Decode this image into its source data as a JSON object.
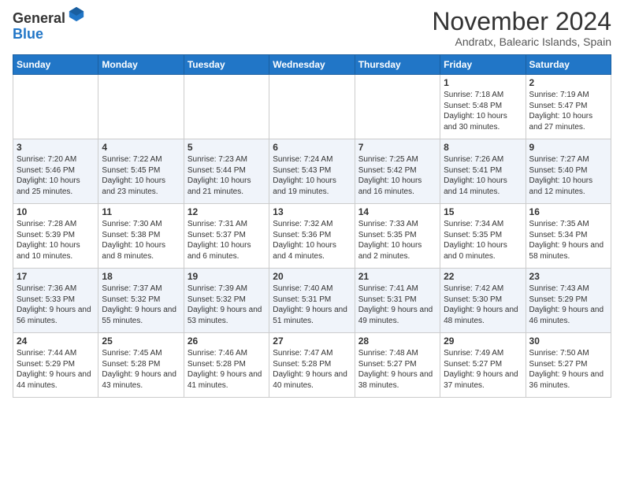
{
  "header": {
    "logo_line1": "General",
    "logo_line2": "Blue",
    "month_title": "November 2024",
    "location": "Andratx, Balearic Islands, Spain"
  },
  "days_of_week": [
    "Sunday",
    "Monday",
    "Tuesday",
    "Wednesday",
    "Thursday",
    "Friday",
    "Saturday"
  ],
  "weeks": [
    [
      {
        "day": "",
        "info": ""
      },
      {
        "day": "",
        "info": ""
      },
      {
        "day": "",
        "info": ""
      },
      {
        "day": "",
        "info": ""
      },
      {
        "day": "",
        "info": ""
      },
      {
        "day": "1",
        "info": "Sunrise: 7:18 AM\nSunset: 5:48 PM\nDaylight: 10 hours and 30 minutes."
      },
      {
        "day": "2",
        "info": "Sunrise: 7:19 AM\nSunset: 5:47 PM\nDaylight: 10 hours and 27 minutes."
      }
    ],
    [
      {
        "day": "3",
        "info": "Sunrise: 7:20 AM\nSunset: 5:46 PM\nDaylight: 10 hours and 25 minutes."
      },
      {
        "day": "4",
        "info": "Sunrise: 7:22 AM\nSunset: 5:45 PM\nDaylight: 10 hours and 23 minutes."
      },
      {
        "day": "5",
        "info": "Sunrise: 7:23 AM\nSunset: 5:44 PM\nDaylight: 10 hours and 21 minutes."
      },
      {
        "day": "6",
        "info": "Sunrise: 7:24 AM\nSunset: 5:43 PM\nDaylight: 10 hours and 19 minutes."
      },
      {
        "day": "7",
        "info": "Sunrise: 7:25 AM\nSunset: 5:42 PM\nDaylight: 10 hours and 16 minutes."
      },
      {
        "day": "8",
        "info": "Sunrise: 7:26 AM\nSunset: 5:41 PM\nDaylight: 10 hours and 14 minutes."
      },
      {
        "day": "9",
        "info": "Sunrise: 7:27 AM\nSunset: 5:40 PM\nDaylight: 10 hours and 12 minutes."
      }
    ],
    [
      {
        "day": "10",
        "info": "Sunrise: 7:28 AM\nSunset: 5:39 PM\nDaylight: 10 hours and 10 minutes."
      },
      {
        "day": "11",
        "info": "Sunrise: 7:30 AM\nSunset: 5:38 PM\nDaylight: 10 hours and 8 minutes."
      },
      {
        "day": "12",
        "info": "Sunrise: 7:31 AM\nSunset: 5:37 PM\nDaylight: 10 hours and 6 minutes."
      },
      {
        "day": "13",
        "info": "Sunrise: 7:32 AM\nSunset: 5:36 PM\nDaylight: 10 hours and 4 minutes."
      },
      {
        "day": "14",
        "info": "Sunrise: 7:33 AM\nSunset: 5:35 PM\nDaylight: 10 hours and 2 minutes."
      },
      {
        "day": "15",
        "info": "Sunrise: 7:34 AM\nSunset: 5:35 PM\nDaylight: 10 hours and 0 minutes."
      },
      {
        "day": "16",
        "info": "Sunrise: 7:35 AM\nSunset: 5:34 PM\nDaylight: 9 hours and 58 minutes."
      }
    ],
    [
      {
        "day": "17",
        "info": "Sunrise: 7:36 AM\nSunset: 5:33 PM\nDaylight: 9 hours and 56 minutes."
      },
      {
        "day": "18",
        "info": "Sunrise: 7:37 AM\nSunset: 5:32 PM\nDaylight: 9 hours and 55 minutes."
      },
      {
        "day": "19",
        "info": "Sunrise: 7:39 AM\nSunset: 5:32 PM\nDaylight: 9 hours and 53 minutes."
      },
      {
        "day": "20",
        "info": "Sunrise: 7:40 AM\nSunset: 5:31 PM\nDaylight: 9 hours and 51 minutes."
      },
      {
        "day": "21",
        "info": "Sunrise: 7:41 AM\nSunset: 5:31 PM\nDaylight: 9 hours and 49 minutes."
      },
      {
        "day": "22",
        "info": "Sunrise: 7:42 AM\nSunset: 5:30 PM\nDaylight: 9 hours and 48 minutes."
      },
      {
        "day": "23",
        "info": "Sunrise: 7:43 AM\nSunset: 5:29 PM\nDaylight: 9 hours and 46 minutes."
      }
    ],
    [
      {
        "day": "24",
        "info": "Sunrise: 7:44 AM\nSunset: 5:29 PM\nDaylight: 9 hours and 44 minutes."
      },
      {
        "day": "25",
        "info": "Sunrise: 7:45 AM\nSunset: 5:28 PM\nDaylight: 9 hours and 43 minutes."
      },
      {
        "day": "26",
        "info": "Sunrise: 7:46 AM\nSunset: 5:28 PM\nDaylight: 9 hours and 41 minutes."
      },
      {
        "day": "27",
        "info": "Sunrise: 7:47 AM\nSunset: 5:28 PM\nDaylight: 9 hours and 40 minutes."
      },
      {
        "day": "28",
        "info": "Sunrise: 7:48 AM\nSunset: 5:27 PM\nDaylight: 9 hours and 38 minutes."
      },
      {
        "day": "29",
        "info": "Sunrise: 7:49 AM\nSunset: 5:27 PM\nDaylight: 9 hours and 37 minutes."
      },
      {
        "day": "30",
        "info": "Sunrise: 7:50 AM\nSunset: 5:27 PM\nDaylight: 9 hours and 36 minutes."
      }
    ]
  ]
}
